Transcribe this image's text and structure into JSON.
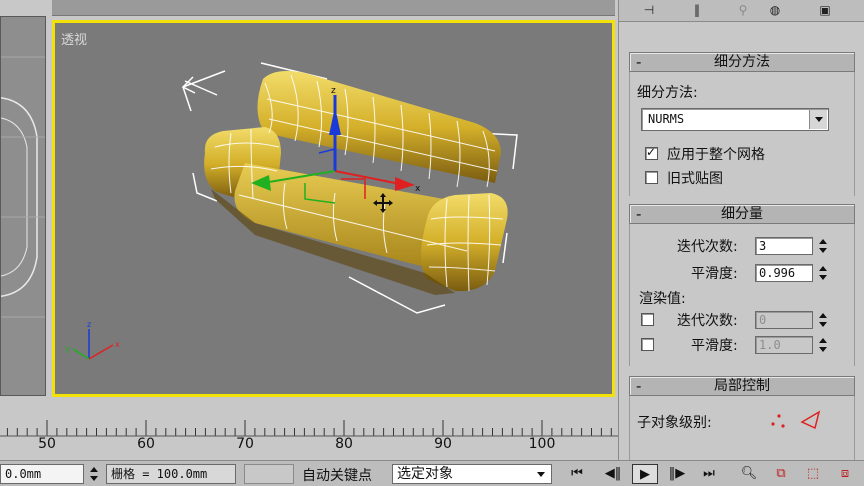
{
  "viewport": {
    "label": "透视"
  },
  "panel": {
    "toolbar_icons": [
      "pin-icon",
      "modifier-stack-icon",
      "light-icon",
      "mouse-icon",
      "config-icon"
    ],
    "rollouts": {
      "subdivision_method": {
        "title": "细分方法",
        "method_label": "细分方法:",
        "method_value": "NURMS",
        "apply_to_mesh_label": "应用于整个网格",
        "apply_to_mesh_checked": true,
        "legacy_map_label": "旧式贴图",
        "legacy_map_checked": false
      },
      "subdivision_amount": {
        "title": "细分量",
        "iterations_label": "迭代次数:",
        "iterations_value": "3",
        "smoothness_label": "平滑度:",
        "smoothness_value": "0.996",
        "render_values_label": "渲染值:",
        "render_iterations_label": "迭代次数:",
        "render_iterations_value": "0",
        "render_smoothness_label": "平滑度:",
        "render_smoothness_value": "1.0"
      },
      "local_control": {
        "title": "局部控制",
        "sub_object_label": "子对象级别:"
      }
    }
  },
  "ruler": {
    "labels": [
      "50",
      "60",
      "70",
      "80",
      "90",
      "100"
    ]
  },
  "status": {
    "coord_value": "0.0mm",
    "grid_label": "栅格 = 100.0mm",
    "auto_key_label": "自动关键点",
    "selection_value": "选定对象"
  },
  "colors": {
    "viewport_border": "#f2e20a",
    "sofa": "#d8b830",
    "gizmo_x": "#e02020",
    "gizmo_y": "#20b020",
    "gizmo_z": "#1a3ad8"
  }
}
